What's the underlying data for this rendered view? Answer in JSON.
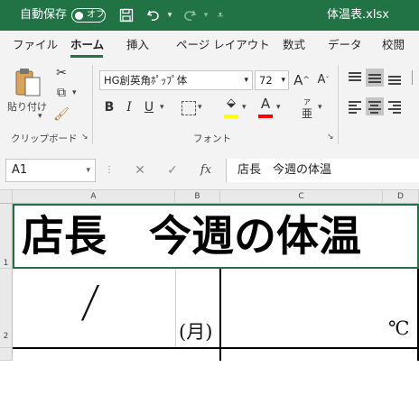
{
  "titlebar": {
    "autosave_label": "自動保存",
    "toggle_label": "オフ",
    "filename": "体温表.xlsx"
  },
  "tabs": [
    {
      "label": "ファイル"
    },
    {
      "label": "ホーム"
    },
    {
      "label": "挿入"
    },
    {
      "label": "ページ レイアウト"
    },
    {
      "label": "数式"
    },
    {
      "label": "データ"
    },
    {
      "label": "校閲"
    }
  ],
  "ribbon": {
    "paste_label": "貼り付け",
    "clipboard_group": "クリップボード",
    "font_name": "HG創英角ﾎﾟｯﾌﾟ体",
    "font_size": "72",
    "font_group": "フォント",
    "accent_color": "#217346",
    "highlight_color": "#ffff00",
    "font_color": "#ff0000"
  },
  "formula_bar": {
    "name_box": "A1",
    "formula": "店長　今週の体温"
  },
  "sheet": {
    "columns": [
      "A",
      "B",
      "C",
      "D"
    ],
    "rows": [
      "1",
      "2"
    ],
    "a1": "店長　今週の体温",
    "a2": "/",
    "b2": "(月)",
    "d2": "℃"
  }
}
